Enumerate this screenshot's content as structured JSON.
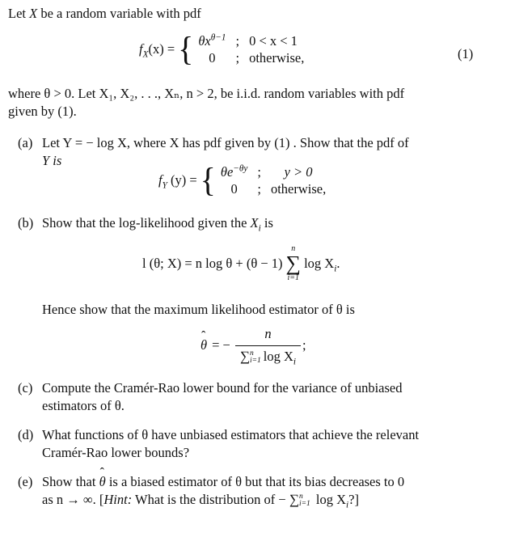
{
  "intro": {
    "text_before": "Let ",
    "var_x": "X",
    "text_after": " be a random variable with pdf"
  },
  "eq1": {
    "lhs": "f",
    "lhs_sub": "X",
    "lhs_arg": "(x) =",
    "row1_expr": "θx",
    "row1_sup": "θ−1",
    "row1_sep": ";",
    "row1_cond": "0 < x < 1",
    "row2_expr": "0",
    "row2_sep": ";",
    "row2_cond": "otherwise,",
    "number": "(1)"
  },
  "para2": {
    "line1": "where θ > 0. Let X₁, X₂, . . ., Xₙ, n > 2, be i.i.d. random variables with pdf",
    "line2": "given by (1)."
  },
  "parts": {
    "a": {
      "label": "(a)",
      "line1": "Let Y = − log X, where X has pdf given by (1) . Show that the pdf of",
      "line2": "Y is",
      "eq": {
        "lhs": "f",
        "lhs_sub": "Y",
        "lhs_arg": " (y) =",
        "row1_expr": "θe",
        "row1_sup": "−θy",
        "row1_sep": ";",
        "row1_cond": "y > 0",
        "row2_expr": "0",
        "row2_sep": ";",
        "row2_cond": "otherwise,"
      }
    },
    "b": {
      "label": "(b)",
      "line1_text": "Show that the log-likelihood given the ",
      "line1_var": "X",
      "line1_sub": "i",
      "line1_end": " is",
      "eq": {
        "lhs": "l (θ; X) = n log θ + (θ − 1)",
        "sum_upper": "n",
        "sum_lower": "i=1",
        "rhs": "log X",
        "rhs_sub": "i",
        "rhs_end": "."
      },
      "hence": "Hence show that the maximum likelihood estimator of θ is",
      "mle": {
        "lhs": "θ",
        "eq_sign": "= −",
        "numerator": "n",
        "den_upper": "n",
        "den_lower": "i=1",
        "den_text": "log X",
        "den_sub": "i",
        "end": ";"
      }
    },
    "c": {
      "label": "(c)",
      "line1": "Compute the Cramér-Rao lower bound for the variance of unbiased",
      "line2": "estimators of θ."
    },
    "d": {
      "label": "(d)",
      "line1": "What functions of θ have unbiased estimators that achieve the relevant",
      "line2": "Cramér-Rao lower bounds?"
    },
    "e": {
      "label": "(e)",
      "line1_a": "Show that ",
      "line1_hat": "θ",
      "line1_b": " is a biased estimator of θ but that its bias decreases to 0",
      "line2_a": "as n → ∞. [",
      "hint": "Hint:",
      "line2_b": " What is the distribution of − ",
      "sum_upper": "n",
      "sum_lower": "i=1",
      "line2_c": " log X",
      "line2_sub": "i",
      "line2_end": "?]"
    }
  }
}
